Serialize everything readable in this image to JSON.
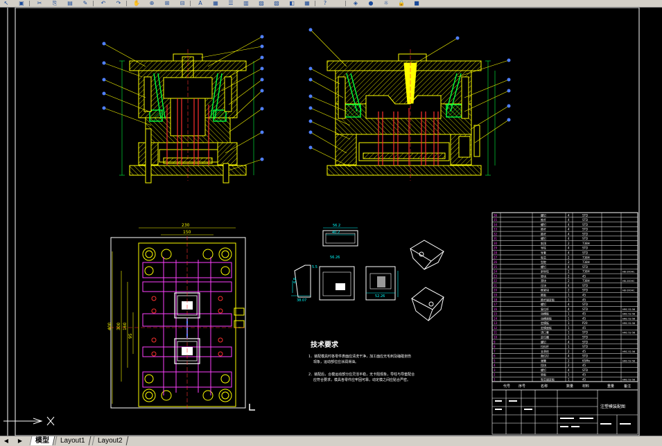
{
  "app": {
    "toolbar_icons": [
      "arrow-icon",
      "save-icon",
      "cut-icon",
      "copy-icon",
      "paste-icon",
      "match-icon",
      "undo-icon",
      "redo-icon",
      "pan-icon",
      "zoom-realtime-icon",
      "zoom-window-icon",
      "zoom-previous-icon",
      "text-style-icon",
      "dimension-style-icon",
      "properties-icon",
      "design-center-icon",
      "tool-palette-icon",
      "sheet-set-icon",
      "markup-icon",
      "calculator-icon",
      "help-icon",
      "layer-icon",
      "light-bulb-icon",
      "sun-icon",
      "lock-icon",
      "color-swatch-icon"
    ],
    "colors": {
      "background": "#000000",
      "toolbar": "#d4d0c8",
      "frame": "#ffffff",
      "yellow": "#ffff00",
      "red": "#ff3030",
      "green": "#00ff40",
      "blue": "#5080ff",
      "magenta": "#ff40ff",
      "cyan": "#00ffff"
    }
  },
  "drawing": {
    "technical_requirements": {
      "title": "技术要求",
      "item1_line1": "1．装配模具时各零件表面应清洗干净，加工面应无毛刺及磕碰划伤",
      "item1_line2": "现象，运动部位应涂润滑油。",
      "item2_line1": "2．装配后，合模运动部分应灵活平稳，无卡阻现象，导柱与导套配合",
      "item2_line2": "应符合要求，模具各零件应牢固可靠，动定模之间应贴合严密。"
    },
    "dimensions": {
      "plan_width_overall": "230",
      "plan_width_inner": "150",
      "plan_height_overall": "400",
      "plan_height_inner": "300",
      "plan_height_short": "160",
      "plan_height_pitch": "95",
      "part_width_top": "56.2",
      "part_height_top": "40.2",
      "part_width_front": "56.26",
      "part_height_front": "5.5",
      "part_side_small": "6.8",
      "part_side_bottom": "38.07",
      "part_right_width": "52.26"
    },
    "bom": {
      "rows": [
        {
          "no": "36",
          "name": "螺钉",
          "qty": "4",
          "material": "STD",
          "note": ""
        },
        {
          "no": "35",
          "name": "推杆",
          "qty": "4",
          "material": "STD",
          "note": ""
        },
        {
          "no": "34",
          "name": "螺钉",
          "qty": "4",
          "material": "STD",
          "note": ""
        },
        {
          "no": "33",
          "name": "推杆",
          "qty": "4",
          "material": "STD",
          "note": ""
        },
        {
          "no": "32",
          "name": "推杆",
          "qty": "4",
          "material": "STD",
          "note": ""
        },
        {
          "no": "31",
          "name": "螺钉",
          "qty": "4",
          "material": "STD",
          "note": ""
        },
        {
          "no": "30",
          "name": "斜顶",
          "qty": "2",
          "material": "738H",
          "note": ""
        },
        {
          "no": "29",
          "name": "导柱",
          "qty": "4",
          "material": "STD",
          "note": ""
        },
        {
          "no": "28",
          "name": "导套",
          "qty": "4",
          "material": "STD",
          "note": ""
        },
        {
          "no": "27",
          "name": "型芯",
          "qty": "2",
          "material": "738H",
          "note": ""
        },
        {
          "no": "26",
          "name": "型腔",
          "qty": "2",
          "material": "738H",
          "note": ""
        },
        {
          "no": "25",
          "name": "螺钉",
          "qty": "4",
          "material": "STD",
          "note": ""
        },
        {
          "no": "24",
          "name": "斜导柱",
          "qty": "2",
          "material": "738H",
          "note": "HB-200HC"
        },
        {
          "no": "23",
          "name": "垫块",
          "qty": "2",
          "material": "45",
          "note": ""
        },
        {
          "no": "22",
          "name": "滑块",
          "qty": "2",
          "material": "738H",
          "note": "HB-200HC"
        },
        {
          "no": "21",
          "name": "压块",
          "qty": "4",
          "material": "STD",
          "note": ""
        },
        {
          "no": "20",
          "name": "楔紧块",
          "qty": "2",
          "material": "STD",
          "note": "HB-200HC"
        },
        {
          "no": "19",
          "name": "推板",
          "qty": "1",
          "material": "45",
          "note": ""
        },
        {
          "no": "18",
          "name": "推杆固定板",
          "qty": "1",
          "material": "45",
          "note": ""
        },
        {
          "no": "17",
          "name": "螺钉",
          "qty": "4",
          "material": "STD",
          "note": ""
        },
        {
          "no": "16",
          "name": "复位杆",
          "qty": "4",
          "material": "STD",
          "note": "HRC-52-56"
        },
        {
          "no": "15",
          "name": "动模板",
          "qty": "1",
          "material": "45",
          "note": "HRC-52-56"
        },
        {
          "no": "14",
          "name": "动模座板",
          "qty": "1",
          "material": "45",
          "note": "HRC-52-56"
        },
        {
          "no": "13",
          "name": "定模板",
          "qty": "1",
          "material": "P20",
          "note": "HRC-52-56"
        },
        {
          "no": "12",
          "name": "定模座板",
          "qty": "1",
          "material": "45",
          "note": ""
        },
        {
          "no": "11",
          "name": "浇口套",
          "qty": "1",
          "material": "STD",
          "note": "HRC-52-56"
        },
        {
          "no": "10",
          "name": "定位圈",
          "qty": "1",
          "material": "STD",
          "note": ""
        },
        {
          "no": "9",
          "name": "螺钉",
          "qty": "4",
          "material": "STD",
          "note": ""
        },
        {
          "no": "8",
          "name": "拉料杆",
          "qty": "1",
          "material": "STD",
          "note": ""
        },
        {
          "no": "7",
          "name": "支承柱",
          "qty": "2",
          "material": "45",
          "note": "HRC-52-56"
        },
        {
          "no": "6",
          "name": "限位钉",
          "qty": "4",
          "material": "STD",
          "note": ""
        },
        {
          "no": "5",
          "name": "弹簧",
          "qty": "2",
          "material": "65Mn",
          "note": "HRC-52-56"
        },
        {
          "no": "4",
          "name": "挡块",
          "qty": "2",
          "material": "45",
          "note": ""
        },
        {
          "no": "3",
          "name": "螺钉",
          "qty": "4",
          "material": "STD",
          "note": ""
        },
        {
          "no": "2",
          "name": "垫板",
          "qty": "1",
          "material": "45",
          "note": ""
        },
        {
          "no": "1",
          "name": "型芯固定板",
          "qty": "1",
          "material": "45",
          "note": "HRC-52-56"
        }
      ],
      "header": {
        "no": "代号",
        "seq": "序号",
        "name": "名称",
        "qty": "数量",
        "material": "材料",
        "weight": "重量",
        "note": "备注"
      }
    },
    "title_block": {
      "drawing_name": "注塑模装配图"
    }
  },
  "layout_tabs": {
    "nav_buttons": [
      "◀",
      "▶"
    ],
    "tabs": [
      {
        "label": "模型",
        "active": true
      },
      {
        "label": "Layout1",
        "active": false
      },
      {
        "label": "Layout2",
        "active": false
      }
    ]
  }
}
